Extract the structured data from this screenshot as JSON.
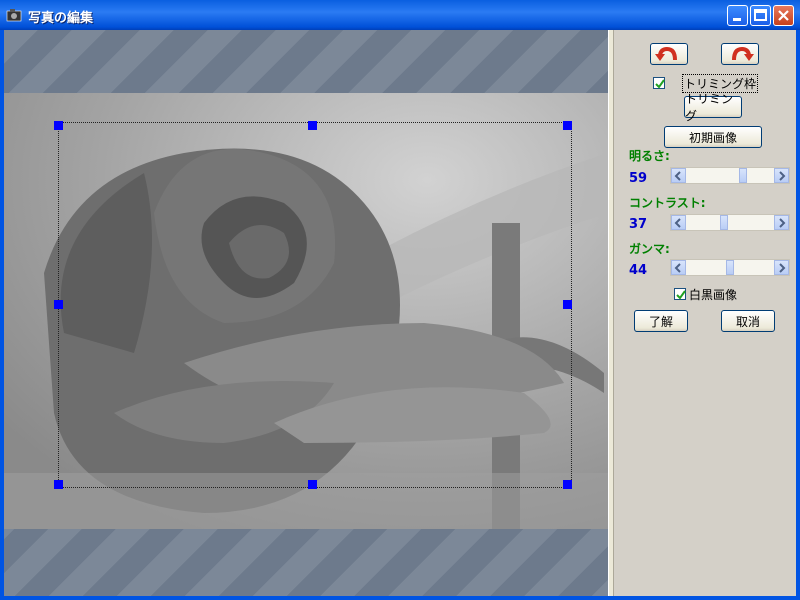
{
  "window": {
    "title": "写真の編集"
  },
  "panel": {
    "rotate_left_icon": "rotate-left-icon",
    "rotate_right_icon": "rotate-right-icon",
    "trim_frame_label": "トリミング枠",
    "trim_frame_checked": true,
    "trim_button": "トリミング",
    "reset_button": "初期画像",
    "brightness": {
      "label": "明るさ:",
      "value": "59"
    },
    "contrast": {
      "label": "コントラスト:",
      "value": "37"
    },
    "gamma": {
      "label": "ガンマ:",
      "value": "44"
    },
    "grayscale_label": "白黒画像",
    "grayscale_checked": true,
    "ok_button": "了解",
    "cancel_button": "取消"
  },
  "colors": {
    "accent": "#0000ff",
    "label_green": "#008000",
    "value_blue": "#0000cc"
  }
}
